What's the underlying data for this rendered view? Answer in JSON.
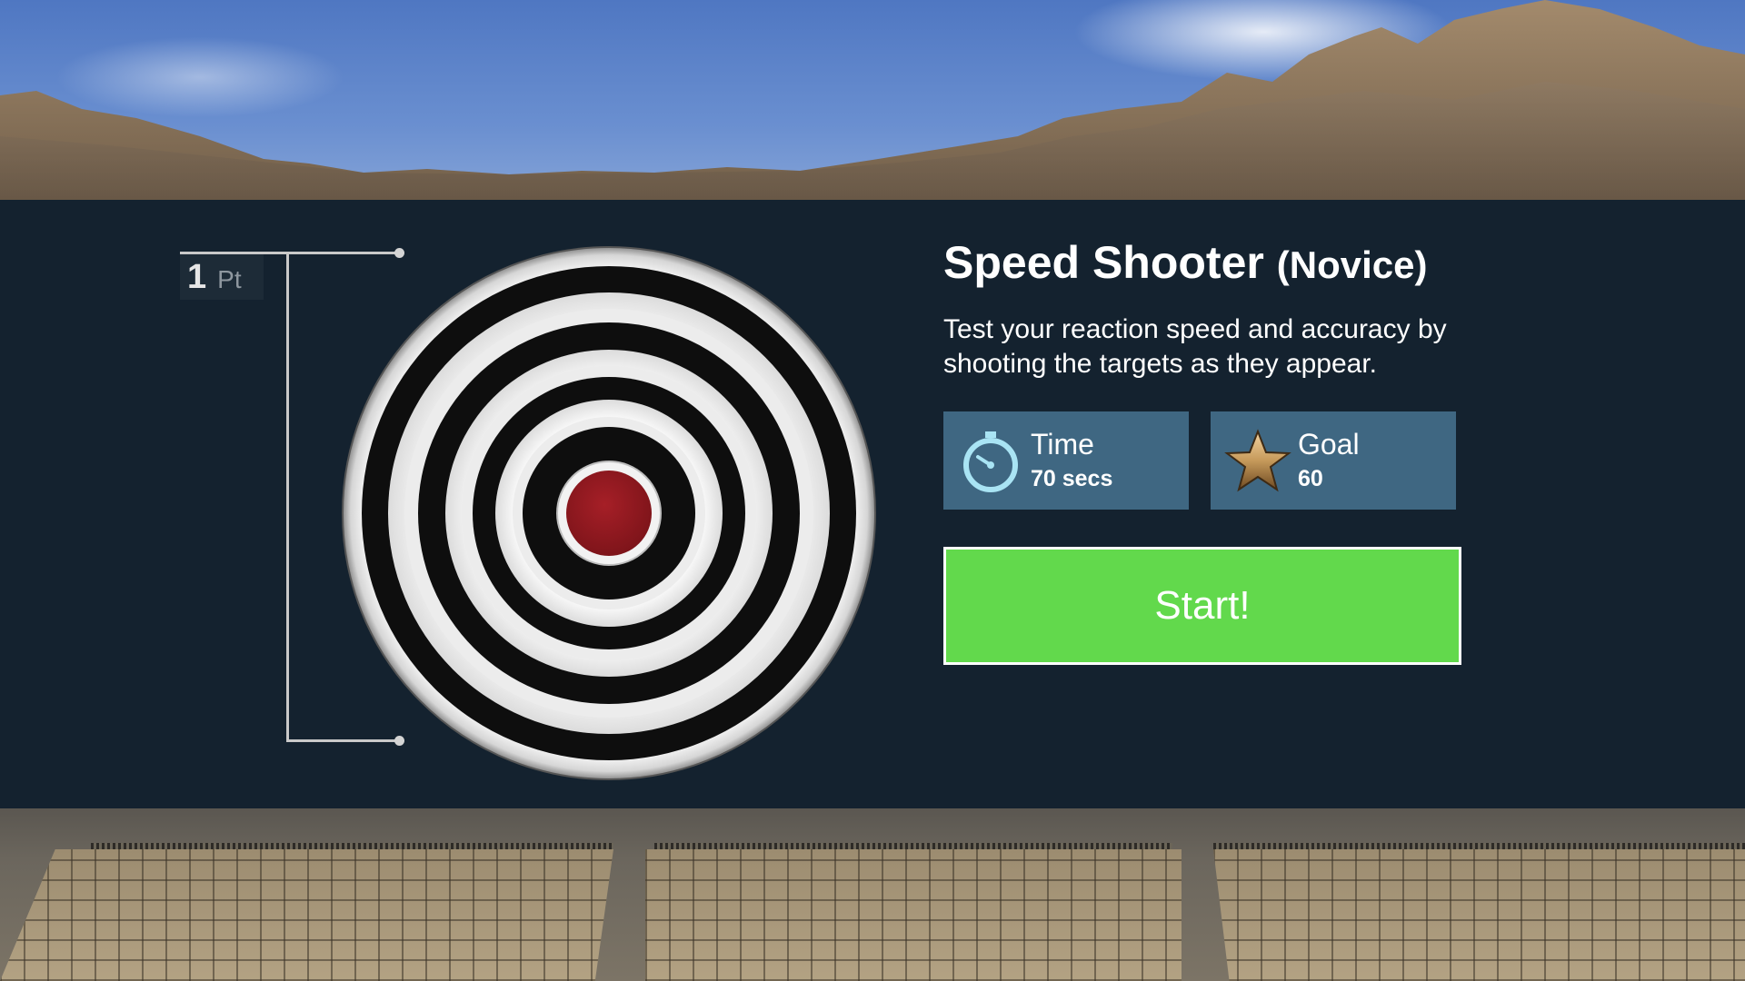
{
  "game": {
    "points": {
      "value": "1",
      "unit": "Pt"
    },
    "mode": {
      "title": "Speed Shooter",
      "difficulty": "(Novice)",
      "description": "Test your reaction speed and accuracy by shooting the targets as they appear."
    },
    "stats": {
      "time": {
        "label": "Time",
        "value": "70 secs",
        "icon": "stopwatch-icon"
      },
      "goal": {
        "label": "Goal",
        "value": "60",
        "icon": "star-icon"
      }
    },
    "start_label": "Start!"
  },
  "colors": {
    "panel_bg": "#14222f",
    "stat_bg": "#3f6782",
    "start_bg": "#62d94c",
    "bullseye": "#9b1b22",
    "stopwatch": "#a9e4f4",
    "star": "#c69a5b"
  }
}
